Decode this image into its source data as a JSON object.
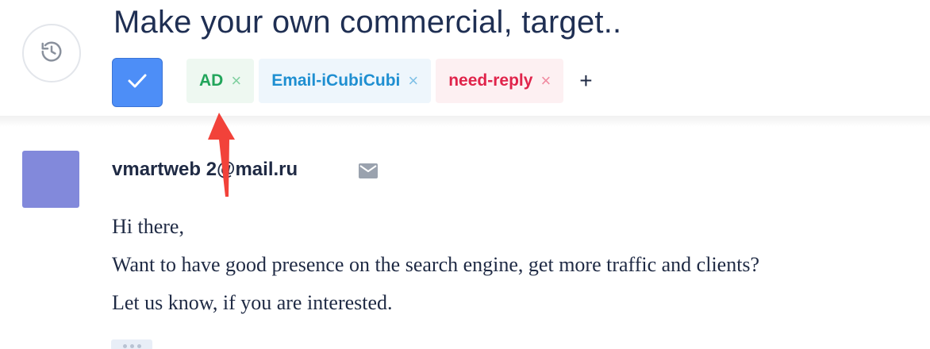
{
  "subject": "Make your own commercial, target..",
  "tags": [
    {
      "label": "AD",
      "remove": "×"
    },
    {
      "label": "Email-iCubiCubi",
      "remove": "×"
    },
    {
      "label": "need-reply",
      "remove": "×"
    }
  ],
  "add_tag_label": "+",
  "message": {
    "sender": "vmartweb 2@mail.ru",
    "lines": [
      "Hi there,",
      "Want to have good presence on the search engine, get more traffic and clients?",
      "Let us know, if you are interested."
    ]
  },
  "colors": {
    "done_button": "#4d8ef7",
    "avatar": "#8289db",
    "tag_ad": "#22a55b",
    "tag_email": "#1f8fd1",
    "tag_reply": "#e0244b",
    "arrow": "#f2423a"
  },
  "icons": {
    "history": "history-icon",
    "done": "check-icon",
    "mail": "envelope-icon"
  }
}
